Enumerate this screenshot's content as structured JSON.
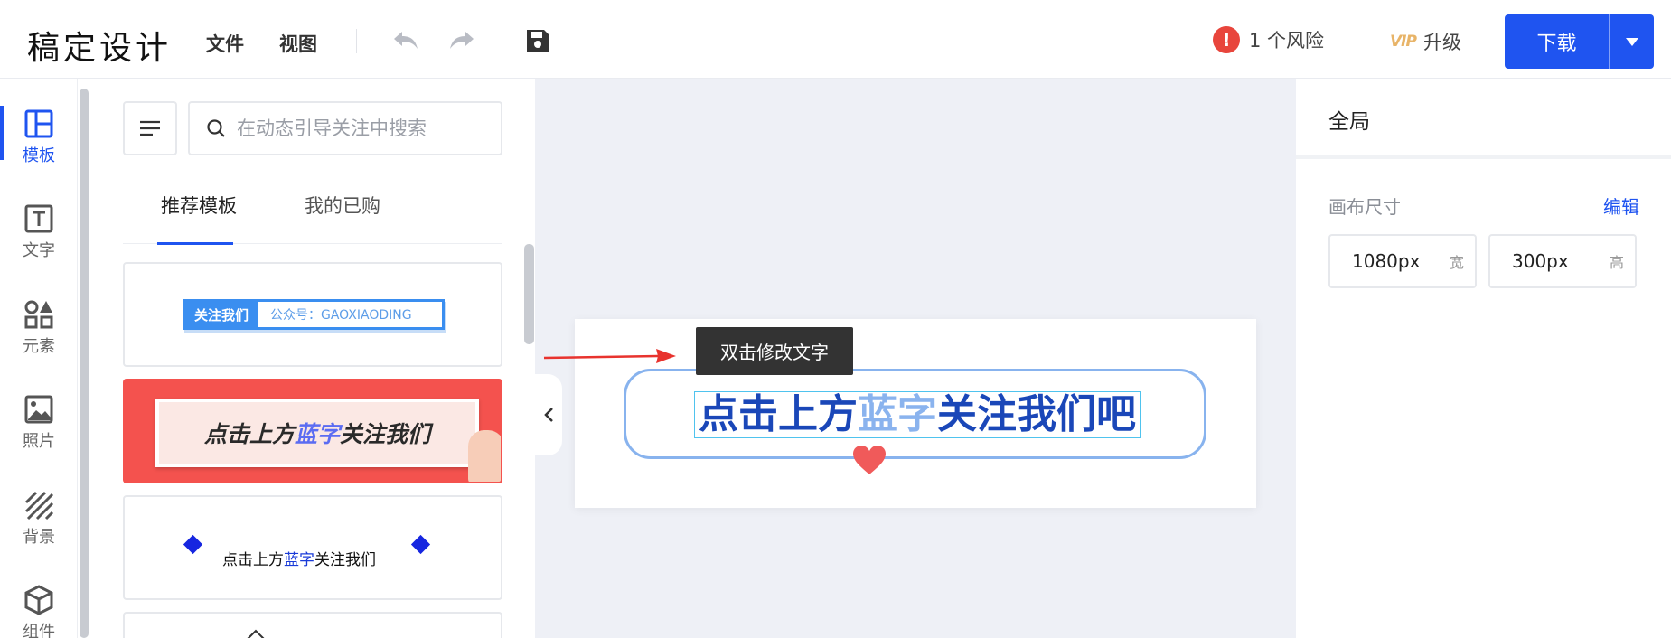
{
  "app": {
    "logo_text": "稿定设计"
  },
  "menu": {
    "file": "文件",
    "view": "视图"
  },
  "header": {
    "risk_count_label": "1 个风险",
    "risk_icon_text": "!",
    "vip_badge": "VIP",
    "upgrade_label": "升级",
    "download_label": "下载"
  },
  "rail": {
    "items": [
      {
        "label": "模板",
        "icon": "template-icon"
      },
      {
        "label": "文字",
        "icon": "text-icon"
      },
      {
        "label": "元素",
        "icon": "elements-icon"
      },
      {
        "label": "照片",
        "icon": "photo-icon"
      },
      {
        "label": "背景",
        "icon": "background-icon"
      },
      {
        "label": "组件",
        "icon": "component-icon"
      }
    ]
  },
  "panel": {
    "search_placeholder": "在动态引导关注中搜索",
    "tabs": [
      {
        "label": "推荐模板"
      },
      {
        "label": "我的已购"
      }
    ],
    "templates": {
      "t1": {
        "left": "关注我们",
        "right": "公众号：GAOXIAODING"
      },
      "t2": {
        "pre": "点击上方",
        "accent": "蓝字",
        "post": "关注我们"
      },
      "t3": {
        "pre": "点击上方",
        "accent": "蓝字",
        "post": "关注我们"
      }
    }
  },
  "canvas": {
    "tooltip": "双击修改文字",
    "headline_pre": "点击上方",
    "headline_accent": "蓝字",
    "headline_post": "关注我们吧"
  },
  "props": {
    "title": "全局",
    "size_label": "画布尺寸",
    "edit_label": "编辑",
    "width_value": "1080px",
    "width_unit": "宽",
    "height_value": "300px",
    "height_unit": "高"
  },
  "colors": {
    "accent": "#1f54f0",
    "risk": "#e8453c",
    "canvas_bg": "#eef0f6",
    "headline": "#1a47b8"
  }
}
